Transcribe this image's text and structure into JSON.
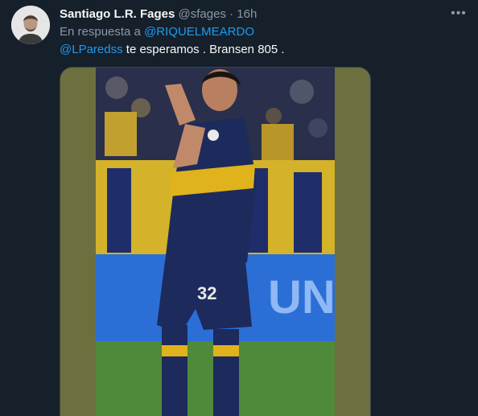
{
  "tweet": {
    "author_name": "Santiago L.R. Fages",
    "author_handle": "@sfages",
    "separator": "·",
    "time": "16h",
    "reply_prefix": "En respuesta a",
    "reply_to": "@RIQUELMEARDO",
    "mention": "@LParedss",
    "body": " te esperamos . Bransen 805 .",
    "more_icon": "more-horizontal-icon",
    "avatar_icon": "avatar-photo",
    "media": {
      "description_icon": "player-photo",
      "jersey_number": "32"
    }
  },
  "colors": {
    "background": "#15202b",
    "text_primary": "#f7f9f9",
    "text_secondary": "#8b98a5",
    "link": "#1d9bf0",
    "jersey_blue": "#1d2a5c",
    "jersey_yellow": "#e0b21c"
  }
}
